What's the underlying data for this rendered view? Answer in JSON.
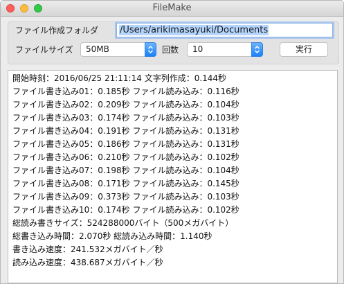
{
  "window": {
    "title": "FileMake"
  },
  "form": {
    "folder_label": "ファイル作成フォルダ",
    "folder_value": "/Users/arikimasayuki/Documents",
    "size_label": "ファイルサイズ",
    "size_value": "50MB",
    "count_label": "回数",
    "count_value": "10",
    "run_label": "実行"
  },
  "log": {
    "lines": [
      "開始時刻：2016/06/25 21:11:14 文字列作成：0.144秒",
      "ファイル書き込み01：0.185秒 ファイル読み込み：0.116秒",
      "ファイル書き込み02：0.209秒 ファイル読み込み：0.104秒",
      "ファイル書き込み03：0.174秒 ファイル読み込み：0.103秒",
      "ファイル書き込み04：0.191秒 ファイル読み込み：0.131秒",
      "ファイル書き込み05：0.186秒 ファイル読み込み：0.131秒",
      "ファイル書き込み06：0.210秒 ファイル読み込み：0.102秒",
      "ファイル書き込み07：0.198秒 ファイル読み込み：0.104秒",
      "ファイル書き込み08：0.171秒 ファイル読み込み：0.145秒",
      "ファイル書き込み09：0.373秒 ファイル読み込み：0.103秒",
      "ファイル書き込み10：0.174秒 ファイル読み込み：0.102秒",
      "総読み書きサイズ：524288000バイト（500メガバイト）",
      "総書き込み時間：2.070秒 総読み込み時間：1.140秒",
      "書き込み速度：241.532メガバイト／秒",
      "読み込み速度：438.687メガバイト／秒"
    ]
  },
  "colors": {
    "selection": "#b4d5fe",
    "focus_ring": "#a9c6f0",
    "popup_arrow": "#1a82fb"
  },
  "icons": {
    "popup_arrow": "updown-chevron-icon"
  }
}
